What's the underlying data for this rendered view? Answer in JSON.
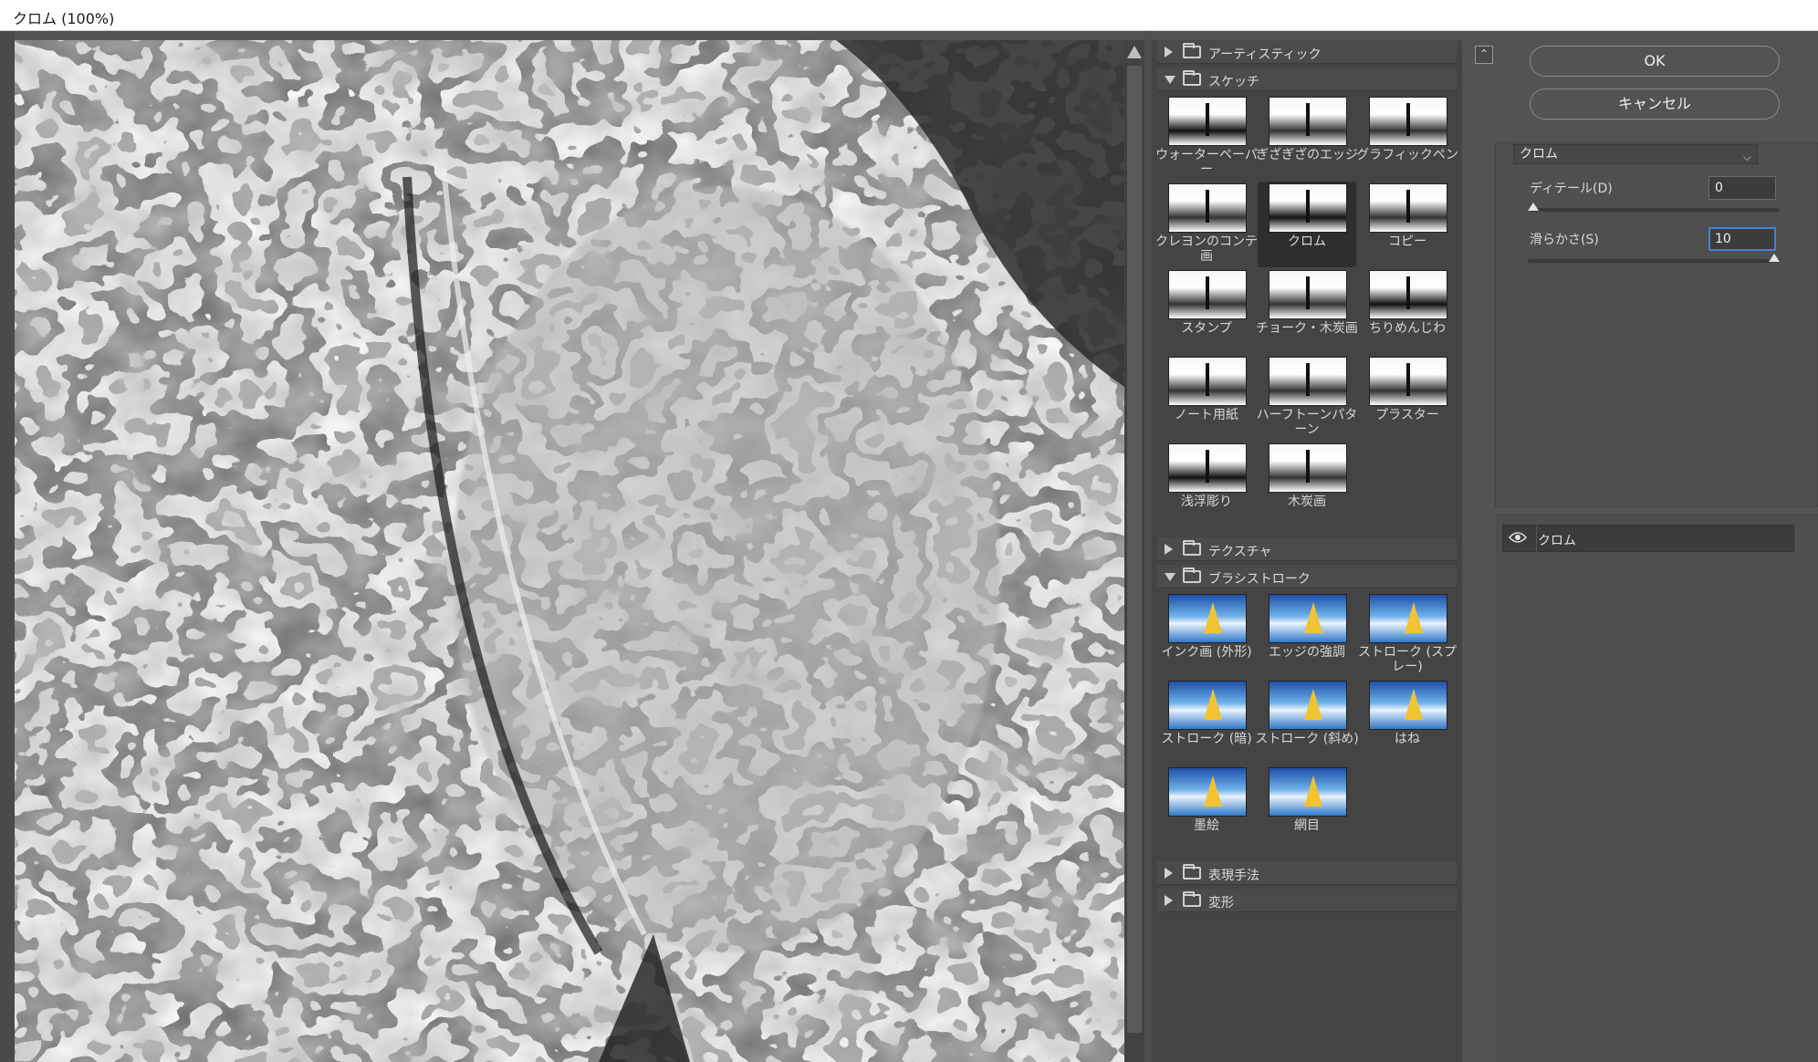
{
  "window": {
    "title": "クロム (100%)"
  },
  "gallery": {
    "categories": [
      {
        "label": "アーティスティック",
        "expanded": false
      },
      {
        "label": "スケッチ",
        "expanded": true,
        "items": [
          "ウォーターペーパー",
          "ぎざぎざのエッジ",
          "グラフィックペン",
          "クレヨンのコンテ画",
          "クロム",
          "コピー",
          "スタンプ",
          "チョーク・木炭画",
          "ちりめんじわ",
          "ノート用紙",
          "ハーフトーンパターン",
          "プラスター",
          "浅浮彫り",
          "木炭画"
        ]
      },
      {
        "label": "テクスチャ",
        "expanded": false
      },
      {
        "label": "ブラシストローク",
        "expanded": true,
        "items": [
          "インク画 (外形)",
          "エッジの強調",
          "ストローク (スプレー)",
          "ストローク (暗)",
          "ストローク (斜め)",
          "はね",
          "墨絵",
          "網目"
        ]
      },
      {
        "label": "表現手法",
        "expanded": false
      },
      {
        "label": "変形",
        "expanded": false
      }
    ],
    "selected_item": "クロム"
  },
  "controls": {
    "ok_label": "OK",
    "cancel_label": "キャンセル",
    "filter_select": "クロム",
    "detail_label": "ディテール(D)",
    "detail_value": "0",
    "smoothness_label": "滑らかさ(S)",
    "smoothness_value": "10",
    "detail_level": 0,
    "smoothness_level": 1.0
  },
  "layers": [
    {
      "label": "クロム",
      "visible": true
    }
  ],
  "icons": {
    "collapse": "collapse-up-icon",
    "eye": "eye-icon",
    "folder": "folder-icon"
  },
  "colors": {
    "accent_focus": "#4a7fd8",
    "panel": "#535353",
    "gallery_bg": "#444444"
  }
}
